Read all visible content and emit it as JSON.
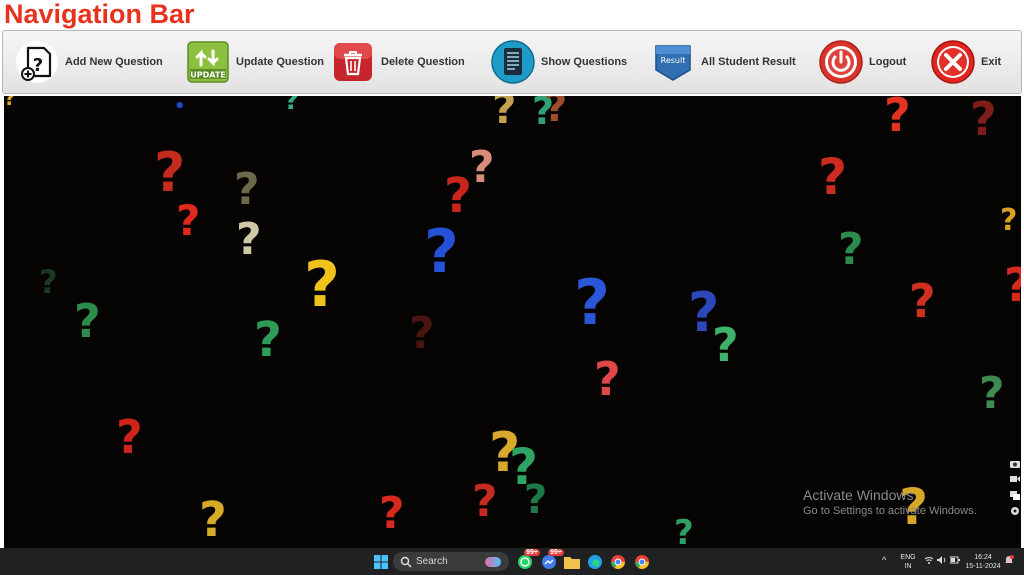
{
  "window": {
    "title": "Navigation Bar"
  },
  "toolbar": {
    "items": [
      {
        "label": "Add New Question",
        "icon": "add-question-icon"
      },
      {
        "label": "Update Question",
        "icon": "update-icon",
        "icon_text": "UPDATE"
      },
      {
        "label": "Delete Question",
        "icon": "trash-icon"
      },
      {
        "label": "Show Questions",
        "icon": "document-icon"
      },
      {
        "label": "All Student Result",
        "icon": "result-badge-icon",
        "icon_text": "Result"
      },
      {
        "label": "Logout",
        "icon": "power-icon"
      },
      {
        "label": "Exit",
        "icon": "close-circle-icon"
      }
    ]
  },
  "watermark": {
    "line1": "Activate Windows",
    "line2": "Go to Settings to activate Windows."
  },
  "taskbar": {
    "search_label": "Search",
    "badge1": "99+",
    "badge2": "99+",
    "language": "ENG",
    "region": "IN",
    "time": "16:24",
    "date": "15-11-2024"
  },
  "colors": {
    "title": "#e8321e",
    "canvas_bg": "#060303",
    "taskbar_bg": "#202123"
  }
}
